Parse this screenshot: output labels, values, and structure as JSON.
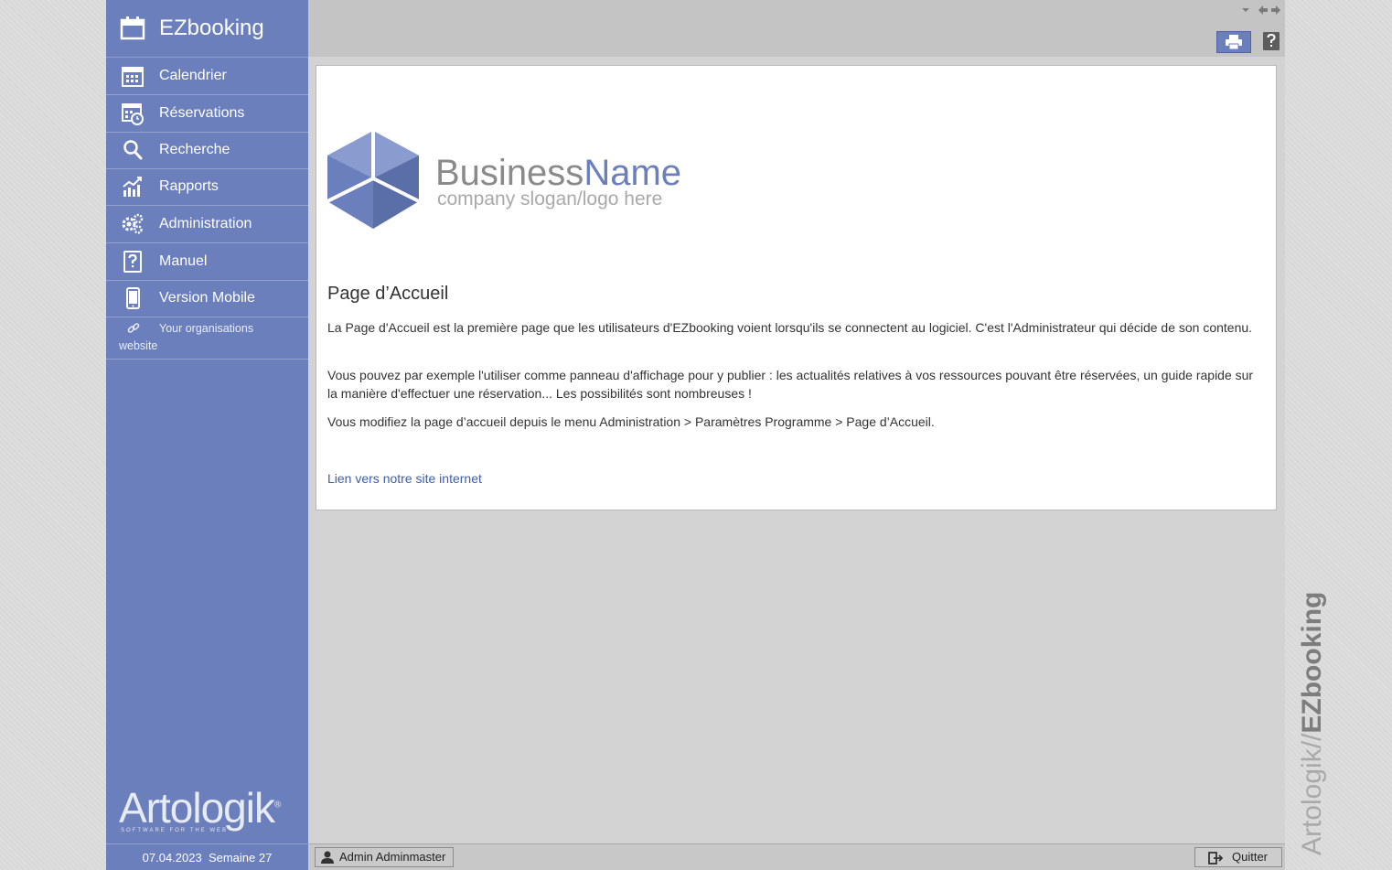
{
  "app": {
    "brand": "EZbooking"
  },
  "sidebar": {
    "items": [
      {
        "label": "Calendrier",
        "icon": "calendar-grid-icon"
      },
      {
        "label": "Réservations",
        "icon": "calendar-clock-icon"
      },
      {
        "label": "Recherche",
        "icon": "search-icon"
      },
      {
        "label": "Rapports",
        "icon": "chart-icon"
      },
      {
        "label": "Administration",
        "icon": "gears-icon"
      },
      {
        "label": "Manuel",
        "icon": "help-book-icon"
      },
      {
        "label": "Version Mobile",
        "icon": "mobile-icon"
      }
    ],
    "org_link": {
      "line1": "Your organisations",
      "line2": "website",
      "icon": "link-icon"
    },
    "logo": {
      "name": "Artologik",
      "mark": "®",
      "tagline": "SOFTWARE FOR THE WEB"
    },
    "footer": {
      "date": "07.04.2023",
      "week": "Semaine 27"
    }
  },
  "content": {
    "logo": {
      "part1": "Business",
      "part2": "Name",
      "slogan": "company slogan/logo here"
    },
    "heading": "Page d’Accueil",
    "paragraphs": [
      "La Page d'Accueil est la première page que les utilisateurs d'EZbooking voient lorsqu'ils se connectent au logiciel. C'est l'Administrateur qui décide de son contenu.",
      "Vous pouvez par exemple l'utiliser comme panneau d'affichage pour y publier : les actualités relatives à vos ressources pouvant être réservées, un guide rapide sur la manière d'effectuer une réservation... Les possibilités sont nombreuses !",
      "Vous modifiez la page d’accueil depuis le menu Administration > Paramètres Programme > Page d’Accueil."
    ],
    "link": "Lien vers notre site internet"
  },
  "bottombar": {
    "user": "Admin Adminmaster",
    "quit": "Quitter"
  },
  "side_brand": {
    "artologik": "Artologik",
    "sep": "//",
    "ez": "EZbooking"
  },
  "colors": {
    "accent": "#6a7fbc",
    "link": "#3f5ca8",
    "artologik_o": "#d12a78"
  }
}
